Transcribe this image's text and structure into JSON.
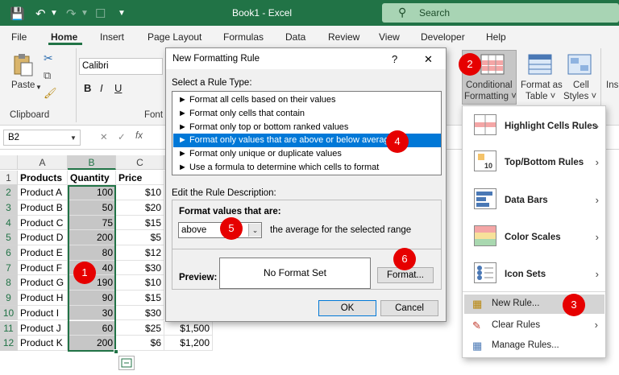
{
  "window": {
    "title": "Book1 - Excel",
    "search_label": "Search"
  },
  "tabs": [
    "File",
    "Home",
    "Insert",
    "Page Layout",
    "Formulas",
    "Data",
    "Review",
    "View",
    "Developer",
    "Help"
  ],
  "ribbon": {
    "paste_label": "Paste",
    "clipboard_label": "Clipboard",
    "font_name": "Calibri",
    "font_label": "Font",
    "conditional_formatting_label": [
      "Conditional",
      "Formatting ˅"
    ],
    "format_as_table_label": [
      "Format as",
      "Table ˅"
    ],
    "cell_styles_label": [
      "Cell",
      "Styles ˅"
    ],
    "partial_label": "Ins"
  },
  "formula_bar": {
    "name_box": "B2",
    "cancel": "✕",
    "confirm": "✓",
    "fx": "fx"
  },
  "columns": [
    "A",
    "B",
    "C"
  ],
  "rows": [
    {
      "n": "1",
      "a": "Products",
      "b": "Quantity",
      "c": "Price"
    },
    {
      "n": "2",
      "a": "Product A",
      "b": "100",
      "c": "$10"
    },
    {
      "n": "3",
      "a": "Product B",
      "b": "50",
      "c": "$20"
    },
    {
      "n": "4",
      "a": "Product C",
      "b": "75",
      "c": "$15"
    },
    {
      "n": "5",
      "a": "Product D",
      "b": "200",
      "c": "$5"
    },
    {
      "n": "6",
      "a": "Product E",
      "b": "80",
      "c": "$12"
    },
    {
      "n": "7",
      "a": "Product F",
      "b": "40",
      "c": "$30"
    },
    {
      "n": "8",
      "a": "Product G",
      "b": "190",
      "c": "$10"
    },
    {
      "n": "9",
      "a": "Product H",
      "b": "90",
      "c": "$15"
    },
    {
      "n": "10",
      "a": "Product I",
      "b": "30",
      "c": "$30"
    },
    {
      "n": "11",
      "a": "Product J",
      "b": "60",
      "c": "$25"
    },
    {
      "n": "12",
      "a": "Product K",
      "b": "200",
      "c": "$6"
    }
  ],
  "extra_values": {
    "row11": "$1,500",
    "row12": "$1,200"
  },
  "dialog": {
    "title": "New Formatting Rule",
    "help": "?",
    "close": "✕",
    "select_rule_type_label": "Select a Rule Type:",
    "rule_types": [
      "► Format all cells based on their values",
      "► Format only cells that contain",
      "► Format only top or bottom ranked values",
      "► Format only values that are above or below average",
      "► Format only unique or duplicate values",
      "► Use a formula to determine which cells to format"
    ],
    "edit_description_label": "Edit the Rule Description:",
    "format_values_label": "Format values that are:",
    "above_value": "above",
    "average_text": "the average for the selected range",
    "preview_label": "Preview:",
    "no_format_text": "No Format Set",
    "format_button": "Format...",
    "ok_button": "OK",
    "cancel_button": "Cancel"
  },
  "menu": {
    "items": [
      "Highlight Cells Rules",
      "Top/Bottom Rules",
      "Data Bars",
      "Color Scales",
      "Icon Sets"
    ],
    "new_rule": "New Rule...",
    "clear_rules": "Clear Rules",
    "manage_rules": "Manage Rules..."
  },
  "markers": [
    "1",
    "2",
    "3",
    "4",
    "5",
    "6"
  ],
  "colors": {
    "excel_green": "#217346",
    "marker_red": "#e60000",
    "selection_blue": "#0078d7"
  }
}
